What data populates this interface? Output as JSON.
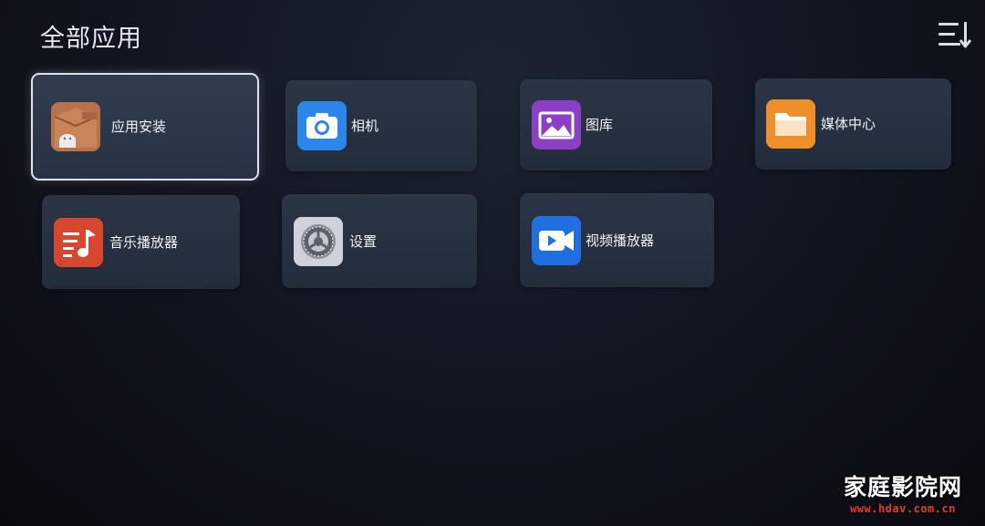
{
  "header": {
    "title": "全部应用",
    "sort_icon": "sort-list-icon"
  },
  "apps": [
    {
      "id": "app-install",
      "label": "应用安装",
      "icon": "app-install-icon",
      "color": "#b8714b",
      "focused": true
    },
    {
      "id": "camera",
      "label": "相机",
      "icon": "camera-icon",
      "color": "#2a86e8",
      "focused": false
    },
    {
      "id": "gallery",
      "label": "图库",
      "icon": "gallery-icon",
      "color": "#8a3fc4",
      "focused": false
    },
    {
      "id": "media-center",
      "label": "媒体中心",
      "icon": "folder-icon",
      "color": "#ee8f2a",
      "focused": false
    },
    {
      "id": "music-player",
      "label": "音乐播放器",
      "icon": "music-icon",
      "color": "#d8462e",
      "focused": false
    },
    {
      "id": "settings",
      "label": "设置",
      "icon": "settings-gear-icon",
      "color": "#b9bec6",
      "focused": false
    },
    {
      "id": "video-player",
      "label": "视频播放器",
      "icon": "video-play-icon",
      "color": "#1f6fe0",
      "focused": false
    }
  ],
  "watermark": {
    "name": "家庭影院网",
    "url": "www.hdav.com.cn"
  }
}
